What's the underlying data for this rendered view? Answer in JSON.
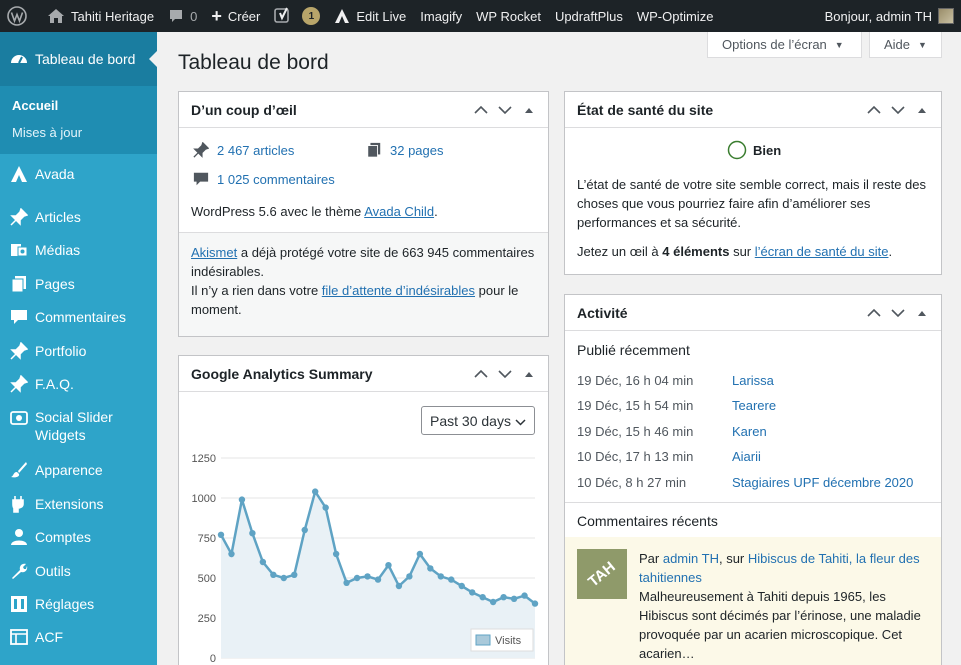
{
  "adminbar": {
    "site_name": "Tahiti Heritage",
    "comments_count": "0",
    "new_label": "Créer",
    "yoast_count": "1",
    "edit_live": "Edit Live",
    "imagify": "Imagify",
    "wp_rocket": "WP Rocket",
    "updraft": "UpdraftPlus",
    "optimize": "WP-Optimize",
    "greeting": "Bonjour, admin TH"
  },
  "sidebar": {
    "dashboard": "Tableau de bord",
    "sub": [
      "Accueil",
      "Mises à jour"
    ],
    "items": [
      {
        "label": "Avada",
        "icon": "avada-icon"
      },
      {
        "label": "Articles",
        "icon": "pin-icon"
      },
      {
        "label": "Médias",
        "icon": "media-icon"
      },
      {
        "label": "Pages",
        "icon": "pages-icon"
      },
      {
        "label": "Commentaires",
        "icon": "comments-icon"
      },
      {
        "label": "Portfolio",
        "icon": "pin-icon"
      },
      {
        "label": "F.A.Q.",
        "icon": "pin-icon"
      },
      {
        "label": "Social Slider Widgets",
        "icon": "slider-icon"
      },
      {
        "label": "Apparence",
        "icon": "brush-icon"
      },
      {
        "label": "Extensions",
        "icon": "plugin-icon"
      },
      {
        "label": "Comptes",
        "icon": "user-icon"
      },
      {
        "label": "Outils",
        "icon": "wrench-icon"
      },
      {
        "label": "Réglages",
        "icon": "settings-icon"
      },
      {
        "label": "ACF",
        "icon": "acf-icon"
      }
    ]
  },
  "screen_options": "Options de l’écran",
  "help": "Aide",
  "page_title": "Tableau de bord",
  "glance": {
    "title": "D’un coup d’œil",
    "articles": "2 467 articles",
    "pages": "32 pages",
    "comments": "1 025 commentaires",
    "version_prefix": "WordPress 5.6 avec le thème ",
    "theme": "Avada Child",
    "version_suffix": ".",
    "akismet": "Akismet",
    "akismet_text": " a déjà protégé votre site de 663 945 commentaires indésirables.",
    "spam_prefix": "Il n’y a rien dans votre ",
    "spam_link": "file d’attente d’indésirables",
    "spam_suffix": " pour le moment."
  },
  "health": {
    "title": "État de santé du site",
    "status": "Bien",
    "text": "L’état de santé de votre site semble correct, mais il reste des choses que vous pourriez faire afin d’améliorer ses performances et sa sécurité.",
    "cta_prefix": "Jetez un œil à ",
    "cta_bold": "4 éléments",
    "cta_mid": " sur ",
    "cta_link": "l’écran de santé du site",
    "cta_suffix": "."
  },
  "analytics": {
    "title": "Google Analytics Summary",
    "period": "Past 30 days",
    "legend": "Visits"
  },
  "chart_data": {
    "type": "area",
    "title": "",
    "xlabel": "",
    "ylabel": "",
    "ylim": [
      0,
      1250
    ],
    "yticks": [
      0,
      250,
      500,
      750,
      1000,
      1250
    ],
    "grid": true,
    "legend": "bottom-right",
    "series": [
      {
        "name": "Visits",
        "color": "#5fa3c4",
        "values": [
          770,
          650,
          990,
          780,
          600,
          520,
          500,
          520,
          800,
          1040,
          940,
          650,
          470,
          500,
          510,
          490,
          580,
          450,
          510,
          650,
          560,
          510,
          490,
          450,
          410,
          380,
          350,
          380,
          370,
          390,
          340
        ]
      }
    ]
  },
  "activity": {
    "title": "Activité",
    "recent_title": "Publié récemment",
    "posts": [
      {
        "date": "19 Déc, 16 h 04 min",
        "title": "Larissa"
      },
      {
        "date": "19 Déc, 15 h 54 min",
        "title": "Tearere"
      },
      {
        "date": "19 Déc, 15 h 46 min",
        "title": "Karen"
      },
      {
        "date": "10 Déc, 17 h 13 min",
        "title": "Aiarii"
      },
      {
        "date": "10 Déc, 8 h 27 min",
        "title": "Stagiaires UPF décembre 2020"
      }
    ],
    "comments_title": "Commentaires récents",
    "comment": {
      "by": "Par ",
      "author": "admin TH",
      "on": ", sur ",
      "post": "Hibiscus de Tahiti, la fleur des tahitiennes",
      "text": "Malheureusement à Tahiti depuis 1965, les Hibiscus sont décimés par l’érinose, une maladie provoquée par un acarien microscopique. Cet acarien…",
      "avatar_text": "TAH"
    }
  }
}
